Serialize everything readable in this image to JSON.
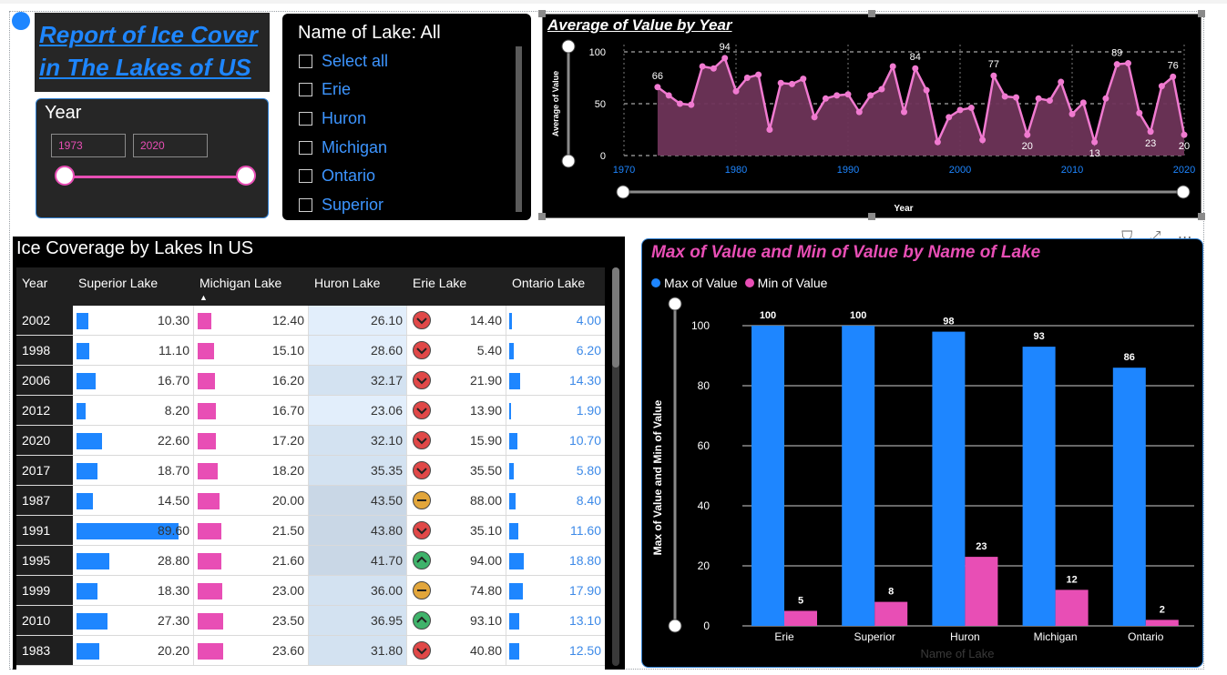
{
  "report_title": "Report of Ice Cover in The Lakes of US",
  "year_slicer": {
    "title": "Year",
    "start": "1973",
    "end": "2020"
  },
  "lake_slicer": {
    "title": "Name of Lake: All",
    "items": [
      "Select all",
      "Erie",
      "Huron",
      "Michigan",
      "Ontario",
      "Superior"
    ]
  },
  "line_chart": {
    "title": "Average of Value by Year",
    "xlabel": "Year",
    "ylabel": "Average of Value",
    "xticks": [
      "1970",
      "1980",
      "1990",
      "2000",
      "2010",
      "2020"
    ],
    "yticks": [
      "0",
      "50",
      "100"
    ]
  },
  "table": {
    "title": "Ice Coverage by Lakes In US",
    "headers": [
      "Year",
      "Superior Lake",
      "Michigan Lake",
      "Huron Lake",
      "Erie Lake",
      "Ontario Lake"
    ],
    "rows": [
      {
        "year": "2002",
        "superior": "10.30",
        "michigan": "12.40",
        "huron": "26.10",
        "erie": "14.40",
        "ontario": "4.00",
        "kpi": "down"
      },
      {
        "year": "1998",
        "superior": "11.10",
        "michigan": "15.10",
        "huron": "28.60",
        "erie": "5.40",
        "ontario": "6.20",
        "kpi": "down"
      },
      {
        "year": "2006",
        "superior": "16.70",
        "michigan": "16.20",
        "huron": "32.17",
        "erie": "21.90",
        "ontario": "14.30",
        "kpi": "down"
      },
      {
        "year": "2012",
        "superior": "8.20",
        "michigan": "16.70",
        "huron": "23.06",
        "erie": "13.90",
        "ontario": "1.90",
        "kpi": "down"
      },
      {
        "year": "2020",
        "superior": "22.60",
        "michigan": "17.20",
        "huron": "32.10",
        "erie": "15.90",
        "ontario": "10.70",
        "kpi": "down"
      },
      {
        "year": "2017",
        "superior": "18.70",
        "michigan": "18.20",
        "huron": "35.35",
        "erie": "35.50",
        "ontario": "5.80",
        "kpi": "down"
      },
      {
        "year": "1987",
        "superior": "14.50",
        "michigan": "20.00",
        "huron": "43.50",
        "erie": "88.00",
        "ontario": "8.40",
        "kpi": "mid"
      },
      {
        "year": "1991",
        "superior": "89.60",
        "michigan": "21.50",
        "huron": "43.80",
        "erie": "35.10",
        "ontario": "11.60",
        "kpi": "down"
      },
      {
        "year": "1995",
        "superior": "28.80",
        "michigan": "21.60",
        "huron": "41.70",
        "erie": "94.00",
        "ontario": "18.80",
        "kpi": "up"
      },
      {
        "year": "1999",
        "superior": "18.30",
        "michigan": "23.00",
        "huron": "36.00",
        "erie": "74.80",
        "ontario": "17.90",
        "kpi": "mid"
      },
      {
        "year": "2010",
        "superior": "27.30",
        "michigan": "23.50",
        "huron": "36.95",
        "erie": "93.10",
        "ontario": "13.10",
        "kpi": "up"
      },
      {
        "year": "1983",
        "superior": "20.20",
        "michigan": "23.60",
        "huron": "31.80",
        "erie": "40.80",
        "ontario": "12.50",
        "kpi": "down"
      }
    ]
  },
  "bar_chart_meta": {
    "title": "Max of Value and Min of Value by Name of Lake",
    "legend_max": "Max of Value",
    "legend_min": "Min of Value",
    "ylabel": "Max of Value and Min of Value",
    "xlabel": "Name of Lake",
    "yticks": [
      "0",
      "20",
      "40",
      "60",
      "80",
      "100"
    ]
  },
  "colors": {
    "blue": "#1e86ff",
    "pink": "#e84eb5",
    "area": "#6e3458"
  },
  "chart_data": [
    {
      "type": "line",
      "title": "Average of Value by Year",
      "xlabel": "Year",
      "ylabel": "Average of Value",
      "xlim": [
        1970,
        2020
      ],
      "ylim": [
        0,
        100
      ],
      "x": [
        1973,
        1974,
        1975,
        1976,
        1977,
        1978,
        1979,
        1980,
        1981,
        1982,
        1983,
        1984,
        1985,
        1986,
        1987,
        1988,
        1989,
        1990,
        1991,
        1992,
        1993,
        1994,
        1995,
        1996,
        1997,
        1998,
        1999,
        2000,
        2001,
        2002,
        2003,
        2004,
        2005,
        2006,
        2007,
        2008,
        2009,
        2010,
        2011,
        2012,
        2013,
        2014,
        2015,
        2016,
        2017,
        2018,
        2019,
        2020
      ],
      "y": [
        66,
        58,
        50,
        49,
        86,
        84,
        94,
        62,
        75,
        78,
        25,
        70,
        69,
        74,
        37,
        55,
        58,
        59,
        42,
        58,
        64,
        86,
        42,
        84,
        63,
        13,
        37,
        44,
        46,
        15,
        77,
        57,
        56,
        20,
        55,
        53,
        71,
        40,
        51,
        13,
        55,
        88,
        89,
        41,
        23,
        67,
        76,
        20
      ],
      "labels": {
        "1973": "66",
        "1979": "94",
        "1996": "84",
        "2003": "77",
        "2006": "20",
        "2012": "13",
        "2014": "89",
        "2017": "23",
        "2019": "76",
        "2020": "20"
      }
    },
    {
      "type": "bar",
      "title": "Max of Value and Min of Value by Name of Lake",
      "categories": [
        "Erie",
        "Superior",
        "Huron",
        "Michigan",
        "Ontario"
      ],
      "series": [
        {
          "name": "Max of Value",
          "values": [
            100,
            100,
            98,
            93,
            86
          ]
        },
        {
          "name": "Min of Value",
          "values": [
            5,
            8,
            23,
            12,
            2
          ]
        }
      ],
      "ylim": [
        0,
        100
      ],
      "xlabel": "Name of Lake",
      "ylabel": "Max of Value and Min of Value"
    }
  ]
}
